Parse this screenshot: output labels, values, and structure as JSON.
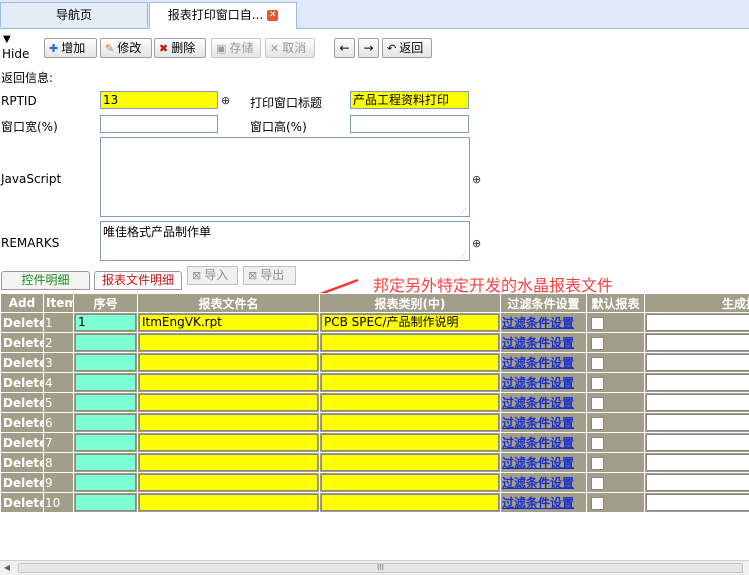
{
  "tabs": [
    {
      "label": "导航页"
    },
    {
      "label": "报表打印窗口自..."
    }
  ],
  "hide_label": "Hide",
  "toolbar": {
    "add": "增加",
    "edit": "修改",
    "delete": "删除",
    "save": "存储",
    "cancel": "取消",
    "back": "返回"
  },
  "form": {
    "return_info_label": "返回信息:",
    "rptid_label": "RPTID",
    "rptid_value": "13",
    "title_label": "打印窗口标题",
    "title_value": "产品工程资料打印",
    "width_label": "窗口宽(%)",
    "width_value": "",
    "height_label": "窗口高(%)",
    "height_value": "",
    "js_label": "JavaScript",
    "js_value": "",
    "remarks_label": "REMARKS",
    "remarks_value": "唯佳格式产品制作单"
  },
  "subtabs": {
    "control_detail": "控件明细",
    "report_file_detail": "报表文件明细",
    "import": "导入",
    "export": "导出"
  },
  "annotation": "邦定另外特定开发的水晶报表文件",
  "grid": {
    "headers": [
      "Add",
      "Item",
      "序号",
      "报表文件名",
      "报表类别(中)",
      "过滤条件设置",
      "默认报表",
      "生成排"
    ],
    "delete_label": "Delete",
    "filter_label": "过滤条件设置",
    "rows": [
      {
        "item": "1",
        "seq": "1",
        "file": "ItmEngVK.rpt",
        "category": "PCB SPEC/产品制作说明"
      },
      {
        "item": "2",
        "seq": "",
        "file": "",
        "category": ""
      },
      {
        "item": "3",
        "seq": "",
        "file": "",
        "category": ""
      },
      {
        "item": "4",
        "seq": "",
        "file": "",
        "category": ""
      },
      {
        "item": "5",
        "seq": "",
        "file": "",
        "category": ""
      },
      {
        "item": "6",
        "seq": "",
        "file": "",
        "category": ""
      },
      {
        "item": "7",
        "seq": "",
        "file": "",
        "category": ""
      },
      {
        "item": "8",
        "seq": "",
        "file": "",
        "category": ""
      },
      {
        "item": "9",
        "seq": "",
        "file": "",
        "category": ""
      },
      {
        "item": "10",
        "seq": "",
        "file": "",
        "category": ""
      }
    ]
  },
  "scrollbar_grip": "III",
  "colors": {
    "accent_yellow": "#ffff00",
    "aqua": "#7fffd4",
    "grid_bg": "#a29e8a",
    "link_blue": "#1a2fc9",
    "annotation_red": "#ff4040"
  }
}
